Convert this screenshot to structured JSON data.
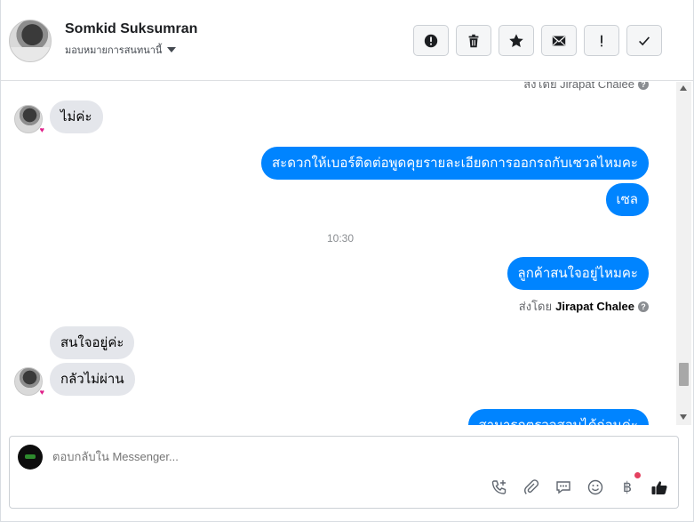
{
  "header": {
    "contact_name": "Somkid Suksumran",
    "assign_label": "มอบหมายการสนทนานี้",
    "actions": [
      "alert-icon",
      "trash-icon",
      "star-icon",
      "mail-icon",
      "exclamation-icon",
      "check-icon"
    ]
  },
  "conversation": {
    "messages": [
      {
        "direction": "in",
        "text": "ไม่ค่ะ"
      },
      {
        "direction": "out",
        "text": "สะดวกให้เบอร์ติดต่อพูดคุยรายละเอียดการออกรถกับเซวลไหมคะ"
      },
      {
        "direction": "out",
        "text": "เซล"
      },
      {
        "direction": "out",
        "text": "ลูกค้าสนใจอยู่ไหมคะ"
      },
      {
        "direction": "in",
        "text": "สนใจอยู่ค่ะ"
      },
      {
        "direction": "in",
        "text": "กลัวไม่ผ่าน"
      },
      {
        "direction": "out",
        "text": "สามารถตรวจสอบได้ก่อนค่ะ"
      }
    ],
    "timestamp": "10:30",
    "sent_by_prefix": "ส่งโดย",
    "sent_by_name": "Jirapat Chalee",
    "top_sent_by": "ส่งโดย Jirapat Chalee"
  },
  "composer": {
    "placeholder": "ตอบกลับใน Messenger...",
    "tools": [
      "call-add-icon",
      "attachment-icon",
      "saved-reply-icon",
      "emoji-icon",
      "baht-icon",
      "like-icon"
    ],
    "baht_symbol": "฿"
  }
}
